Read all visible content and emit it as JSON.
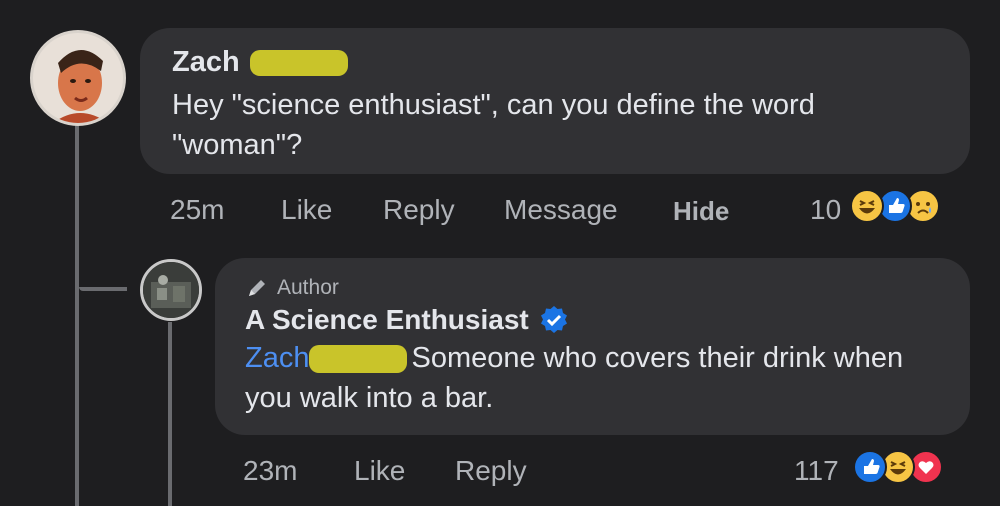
{
  "comment": {
    "author_name": "Zach",
    "text": "Hey \"science enthusiast\", can you define the word \"woman\"?",
    "time": "25m",
    "actions": {
      "like": "Like",
      "reply": "Reply",
      "message": "Message",
      "hide": "Hide"
    },
    "reaction_count": "10",
    "reactions": [
      "laugh-icon",
      "like-icon",
      "sad-icon"
    ]
  },
  "reply": {
    "badge": "Author",
    "author_name": "A Science Enthusiast",
    "mention": "Zach",
    "text": "Someone who covers their drink when you walk into a bar.",
    "time": "23m",
    "actions": {
      "like": "Like",
      "reply": "Reply"
    },
    "reaction_count": "117",
    "reactions": [
      "like-icon",
      "laugh-icon",
      "love-icon"
    ]
  },
  "colors": {
    "background": "#1e1e20",
    "bubble": "#313134",
    "mention_link": "#4d8ff2",
    "verified_badge": "#1b74e4",
    "redaction": "#c9c42a"
  }
}
